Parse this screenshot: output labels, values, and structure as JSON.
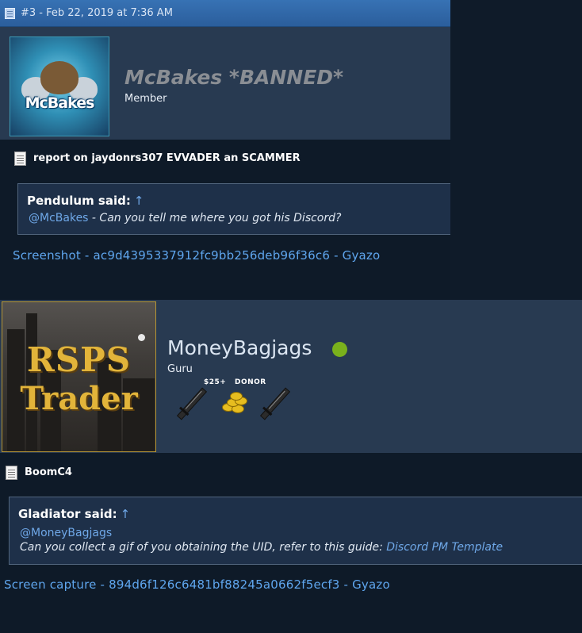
{
  "post1": {
    "header_date": "#3 - Feb 22, 2019 at 7:36 AM",
    "avatar_text": "McBakes",
    "username": "McBakes *BANNED*",
    "user_title": "Member",
    "thread_title": "report on jaydonrs307 EVVADER an SCAMMER",
    "quote": {
      "author": "Pendulum said:",
      "arrow": "↑",
      "mention": "@McBakes",
      "text": " - Can you tell me where you got his Discord?"
    },
    "link": "Screenshot - ac9d4395337912fc9bb256deb96f36c6 - Gyazo"
  },
  "post2": {
    "avatar_line1": "RSPS",
    "avatar_line2": "Trader",
    "username": "MoneyBagjags",
    "online_color": "#7ab11c",
    "user_title": "Guru",
    "badges": [
      "$25+",
      "DONOR"
    ],
    "thread_title": "BoomC4",
    "quote": {
      "author": "Gladiator said:",
      "arrow": "↑",
      "mention": "@MoneyBagjags",
      "text": "Can you collect a gif of you obtaining the UID, refer to this guide: ",
      "link": "Discord PM Template"
    },
    "link": "Screen capture - 894d6f126c6481bf88245a0662f5ecf3 - Gyazo"
  },
  "colors": {
    "header_blue": "#2b5e9c",
    "panel": "#283a51",
    "body_dark": "#0e1a28",
    "link_blue": "#5fa6ee",
    "banned_gray": "#8a8e94"
  }
}
